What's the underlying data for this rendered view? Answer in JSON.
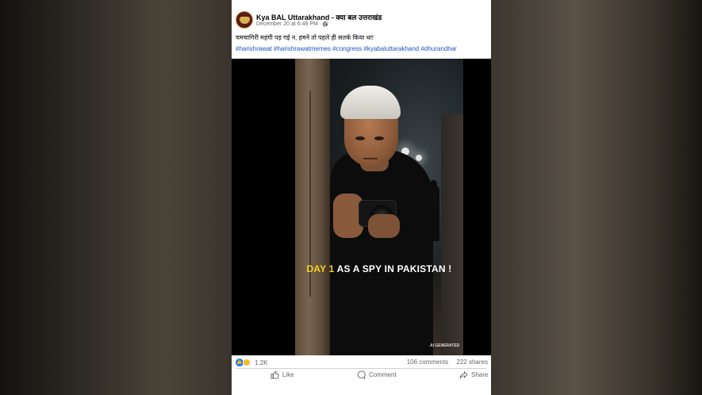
{
  "post": {
    "page_name": "Kya BAL Uttarakhand - क्या बल उत्तराखंड",
    "timestamp": "December 20 at 6:48 PM",
    "separator": "·",
    "text": "चमचागिरी महंगी पड़ गई न, हमने तो पहले ही सतर्क किया था!",
    "hashtags": "#harishrawat #harishrawatmemes #congress #kyabaluttarakhand #dhurandhar"
  },
  "media": {
    "caption_highlight": "DAY 1",
    "caption_rest": " AS A SPY IN PAKISTAN !",
    "ai_label": "AI GENERATED",
    "highlight_color": "#f2d21b"
  },
  "footer": {
    "reaction_icons": [
      "like-icon",
      "haha-icon"
    ],
    "reaction_count": "1.2K",
    "comments": "106 comments",
    "shares": "222 shares",
    "actions": {
      "like": "Like",
      "comment": "Comment",
      "share": "Share"
    }
  },
  "colors": {
    "link": "#1a56c4",
    "like_blue": "#1877f2",
    "meta_gray": "#65676b"
  }
}
